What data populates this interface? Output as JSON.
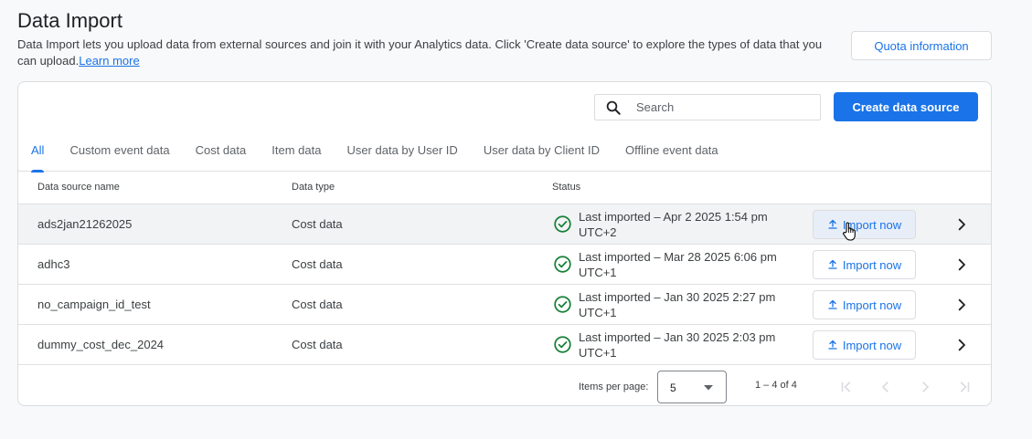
{
  "page": {
    "title": "Data Import",
    "description": "Data Import lets you upload data from external sources and join it with your Analytics data. Click 'Create data source' to explore the types of data that you can upload.",
    "learn_more": "Learn more",
    "quota_button": "Quota information"
  },
  "toolbar": {
    "search_placeholder": "Search",
    "create_button": "Create data source"
  },
  "tabs": [
    {
      "label": "All",
      "active": true
    },
    {
      "label": "Custom event data",
      "active": false
    },
    {
      "label": "Cost data",
      "active": false
    },
    {
      "label": "Item data",
      "active": false
    },
    {
      "label": "User data by User ID",
      "active": false
    },
    {
      "label": "User data by Client ID",
      "active": false
    },
    {
      "label": "Offline event data",
      "active": false
    }
  ],
  "table": {
    "columns": {
      "name": "Data source name",
      "type": "Data type",
      "status": "Status"
    },
    "rows": [
      {
        "name": "ads2jan21262025",
        "type": "Cost data",
        "status_line1": "Last imported – Apr 2 2025 1:54 pm",
        "status_line2": "UTC+2",
        "action": "Import now"
      },
      {
        "name": "adhc3",
        "type": "Cost data",
        "status_line1": "Last imported – Mar 28 2025 6:06 pm",
        "status_line2": "UTC+1",
        "action": "Import now"
      },
      {
        "name": "no_campaign_id_test",
        "type": "Cost data",
        "status_line1": "Last imported – Jan 30 2025 2:27 pm",
        "status_line2": "UTC+1",
        "action": "Import now"
      },
      {
        "name": "dummy_cost_dec_2024",
        "type": "Cost data",
        "status_line1": "Last imported – Jan 30 2025 2:03 pm",
        "status_line2": "UTC+1",
        "action": "Import now"
      }
    ]
  },
  "pagination": {
    "items_per_page_label": "Items per page:",
    "items_per_page": "5",
    "range": "1 – 4 of 4"
  },
  "colors": {
    "accent": "#1a73e8",
    "success": "#188038",
    "disabled": "#dadce0"
  }
}
